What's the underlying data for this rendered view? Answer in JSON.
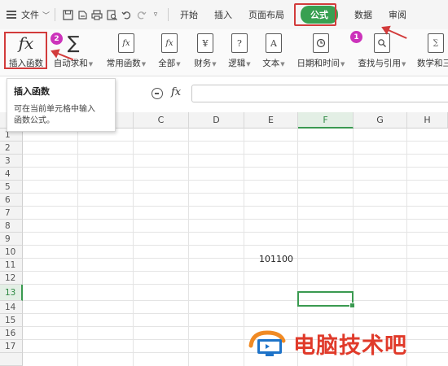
{
  "menu": {
    "file_label": "文件",
    "tabs": [
      "开始",
      "插入",
      "页面布局",
      "公式",
      "数据",
      "审阅"
    ],
    "active_tab": "公式"
  },
  "ribbon": {
    "buttons": [
      {
        "label": "插入函数",
        "icon": "fx-icon",
        "caret": false
      },
      {
        "label": "自动求和",
        "icon": "sigma-icon",
        "caret": true
      },
      {
        "label": "常用函数",
        "icon": "common-functions-icon",
        "caret": true
      },
      {
        "label": "全部",
        "icon": "all-functions-icon",
        "caret": true
      },
      {
        "label": "财务",
        "icon": "finance-icon",
        "caret": true
      },
      {
        "label": "逻辑",
        "icon": "logic-icon",
        "caret": true
      },
      {
        "label": "文本",
        "icon": "text-icon",
        "caret": true
      },
      {
        "label": "日期和时间",
        "icon": "date-time-icon",
        "caret": true
      },
      {
        "label": "查找与引用",
        "icon": "lookup-icon",
        "caret": true
      },
      {
        "label": "数学和三",
        "icon": "math-icon",
        "caret": false
      }
    ],
    "icon_glyphs": {
      "finance": "¥",
      "logic": "?",
      "text": "A"
    }
  },
  "annotations": {
    "badge_1": "1",
    "badge_2": "2"
  },
  "tooltip": {
    "title": "插入函数",
    "line1": "可在当前单元格中输入",
    "line2": "函数公式。"
  },
  "formula_bar": {
    "fx_label": "fx",
    "value": ""
  },
  "grid": {
    "columns": [
      "C",
      "D",
      "E",
      "F",
      "G",
      "H"
    ],
    "selected_column": "F",
    "rows": [
      "1",
      "2",
      "3",
      "4",
      "5",
      "6",
      "7",
      "8",
      "9",
      "10",
      "11",
      "12",
      "13",
      "14",
      "15",
      "16",
      "17"
    ],
    "selected_row": "13",
    "cells": {
      "E10": "101100"
    }
  },
  "watermark": {
    "text": "电脑技术吧"
  },
  "colors": {
    "accent_green": "#38a051",
    "highlight_red": "#d23b3b",
    "badge_purple": "#cc33bb",
    "watermark_red": "#e03a2a"
  }
}
